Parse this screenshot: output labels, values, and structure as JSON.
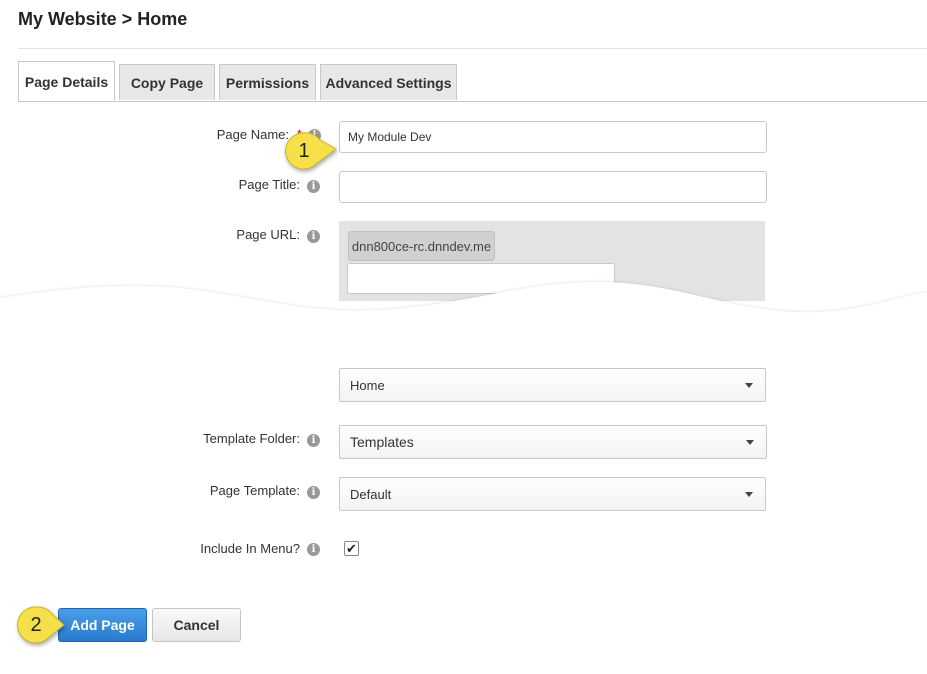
{
  "breadcrumb": "My Website > Home",
  "tabs": [
    {
      "label": "Page Details",
      "active": true
    },
    {
      "label": "Copy Page",
      "active": false
    },
    {
      "label": "Permissions",
      "active": false
    },
    {
      "label": "Advanced Settings",
      "active": false
    }
  ],
  "form": {
    "page_name": {
      "label": "Page Name:",
      "value": "My Module Dev"
    },
    "page_title": {
      "label": "Page Title:",
      "value": ""
    },
    "page_url": {
      "label": "Page URL:",
      "domain": "dnn800ce-rc.dnndev.me",
      "value": ""
    },
    "parent_page": {
      "value": "Home"
    },
    "template_folder": {
      "label": "Template Folder:",
      "value": "Templates"
    },
    "page_template": {
      "label": "Page Template:",
      "value": "Default"
    },
    "include_in_menu": {
      "label": "Include In Menu?",
      "checked": true,
      "mark": "✔"
    }
  },
  "buttons": {
    "add_page": "Add Page",
    "cancel": "Cancel"
  },
  "callouts": {
    "one": "1",
    "two": "2"
  },
  "icons": {
    "info": "i",
    "caret": "caret-down-icon",
    "checkmark": "checkmark-icon"
  },
  "colors": {
    "primary": "#2a7bd0",
    "callout": "#f5e04a",
    "tab_bg": "#e8e8e8"
  }
}
